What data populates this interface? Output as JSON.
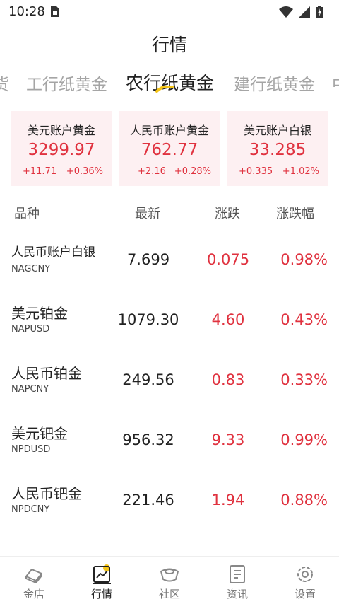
{
  "status_bar": {
    "time": "10:28"
  },
  "header": {
    "title": "行情"
  },
  "tabs": [
    {
      "label": "货"
    },
    {
      "label": "工行纸黄金"
    },
    {
      "label": "农行纸黄金",
      "active": true
    },
    {
      "label": "建行纸黄金"
    },
    {
      "label": "中"
    }
  ],
  "cards": [
    {
      "name": "美元账户黄金",
      "price": "3299.97",
      "change": "+11.71",
      "pct": "+0.36%"
    },
    {
      "name": "人民币账户黄金",
      "price": "762.77",
      "change": "+2.16",
      "pct": "+0.28%"
    },
    {
      "name": "美元账户白银",
      "price": "33.285",
      "change": "+0.335",
      "pct": "+1.02%"
    }
  ],
  "table": {
    "headers": {
      "name": "品种",
      "price": "最新",
      "change": "涨跌",
      "pct": "涨跌幅"
    },
    "rows": [
      {
        "name": "人民币账户白银",
        "code": "NAGCNY",
        "price": "7.699",
        "change": "0.075",
        "pct": "0.98%"
      },
      {
        "name": "美元铂金",
        "code": "NAPUSD",
        "price": "1079.30",
        "change": "4.60",
        "pct": "0.43%"
      },
      {
        "name": "人民币铂金",
        "code": "NAPCNY",
        "price": "249.56",
        "change": "0.83",
        "pct": "0.33%"
      },
      {
        "name": "美元钯金",
        "code": "NPDUSD",
        "price": "956.32",
        "change": "9.33",
        "pct": "0.99%"
      },
      {
        "name": "人民币钯金",
        "code": "NPDCNY",
        "price": "221.46",
        "change": "1.94",
        "pct": "0.88%"
      }
    ]
  },
  "bottom_nav": [
    {
      "label": "金店",
      "icon": "gold-bar-icon"
    },
    {
      "label": "行情",
      "icon": "chart-icon",
      "active": true
    },
    {
      "label": "社区",
      "icon": "ingot-icon"
    },
    {
      "label": "资讯",
      "icon": "document-icon"
    },
    {
      "label": "设置",
      "icon": "gear-icon"
    }
  ],
  "colors": {
    "up": "#e0323f",
    "card_bg": "#fdf0f2",
    "accent": "#f5c518"
  }
}
